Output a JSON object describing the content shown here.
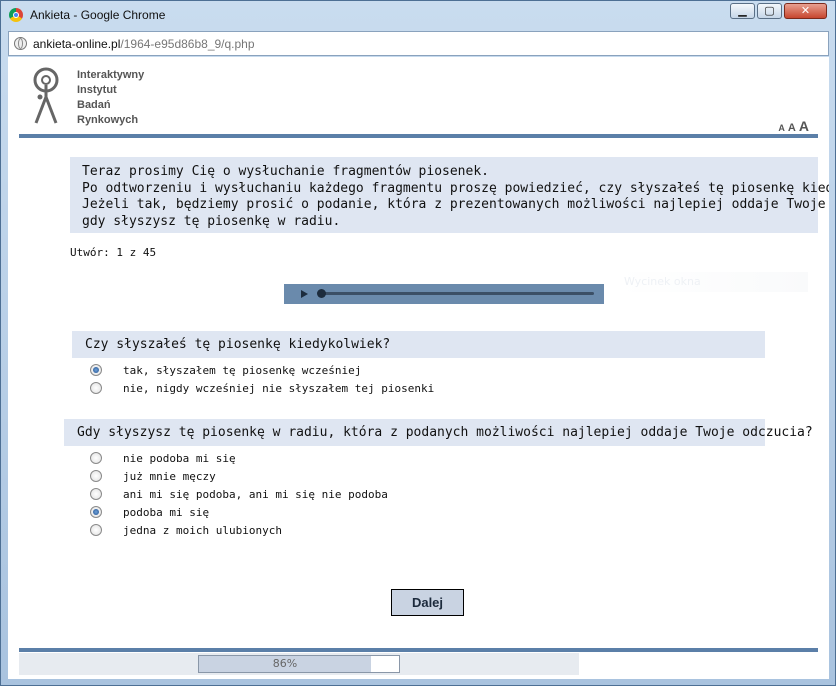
{
  "window": {
    "title": "Ankieta - Google Chrome",
    "minimize": "▁",
    "maximize": "▢",
    "close": "✕"
  },
  "address": {
    "host": "ankieta-online.pl",
    "path": "/1964-e95d86b8_9/q.php"
  },
  "logo": {
    "lines": [
      "Interaktywny",
      "Instytut",
      "Badań",
      "Rynkowych"
    ]
  },
  "font_size": {
    "small": "A",
    "medium": "A",
    "large": "A"
  },
  "intro": {
    "lines": [
      "Teraz prosimy Cię o wysłuchanie fragmentów piosenek.",
      "Po odtworzeniu i wysłuchaniu każdego fragmentu proszę powiedzieć, czy słyszałeś tę piosenkę kiedykolwiek.",
      "Jeżeli tak, będziemy prosić o podanie, która z prezentowanych możliwości najlepiej oddaje Twoje odczucia,",
      "gdy słyszysz tę piosenkę w radiu."
    ]
  },
  "counter": "Utwór: 1 z 45",
  "ghost_text": "Wycinek okna",
  "questions": [
    {
      "text": "Czy słyszałeś tę piosenkę kiedykolwiek?",
      "options": [
        {
          "label": "tak, słyszałem tę piosenkę wcześniej",
          "checked": true
        },
        {
          "label": "nie, nigdy wcześniej nie słyszałem tej piosenki",
          "checked": false
        }
      ]
    },
    {
      "text": "Gdy słyszysz tę piosenkę w radiu, która z podanych możliwości najlepiej oddaje Twoje odczucia?",
      "options": [
        {
          "label": "nie podoba mi się",
          "checked": false
        },
        {
          "label": "już mnie męczy",
          "checked": false
        },
        {
          "label": "ani mi się podoba, ani mi się nie podoba",
          "checked": false
        },
        {
          "label": "podoba mi się",
          "checked": true
        },
        {
          "label": "jedna z moich ulubionych",
          "checked": false
        }
      ]
    }
  ],
  "next_label": "Dalej",
  "progress": {
    "value": 86,
    "label": "86%"
  },
  "colors": {
    "accent": "#5b7fa8",
    "question_bg": "#dfe6f2",
    "player": "#6a8aac"
  }
}
